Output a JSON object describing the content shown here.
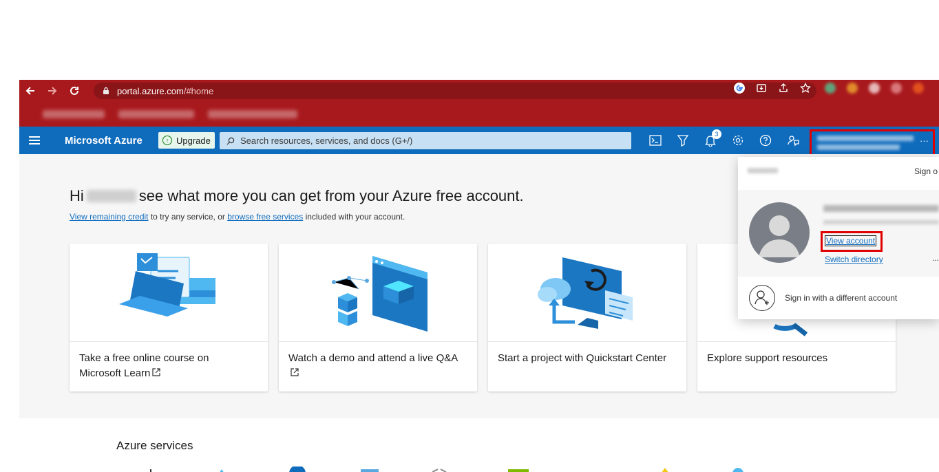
{
  "browser": {
    "url_host": "portal.azure.com",
    "url_path": "/#home"
  },
  "header": {
    "brand": "Microsoft Azure",
    "upgrade_label": "Upgrade",
    "search_placeholder": "Search resources, services, and docs (G+/)",
    "notification_count": "3"
  },
  "main": {
    "greeting_before": "Hi",
    "greeting_after": "see what more you can get from your Azure free account.",
    "sub_link1": "View remaining credit",
    "sub_text1": " to try any service, or ",
    "sub_link2": "browse free services",
    "sub_text2": " included with your account.",
    "cards": [
      {
        "label": "Take a free online course on Microsoft Learn"
      },
      {
        "label": "Watch a demo and attend a live Q&A"
      },
      {
        "label": "Start a project with Quickstart Center"
      },
      {
        "label": "Explore support resources"
      }
    ],
    "services_title": "Azure services"
  },
  "popup": {
    "sign_out": "Sign o",
    "view_account": "View account",
    "switch_directory": "Switch directory",
    "more": "...",
    "sign_in_other": "Sign in with a different account"
  },
  "colors": {
    "browser_chrome": "#a8191d",
    "azure_blue": "#0f6cbd",
    "highlight_red": "#e00000"
  }
}
